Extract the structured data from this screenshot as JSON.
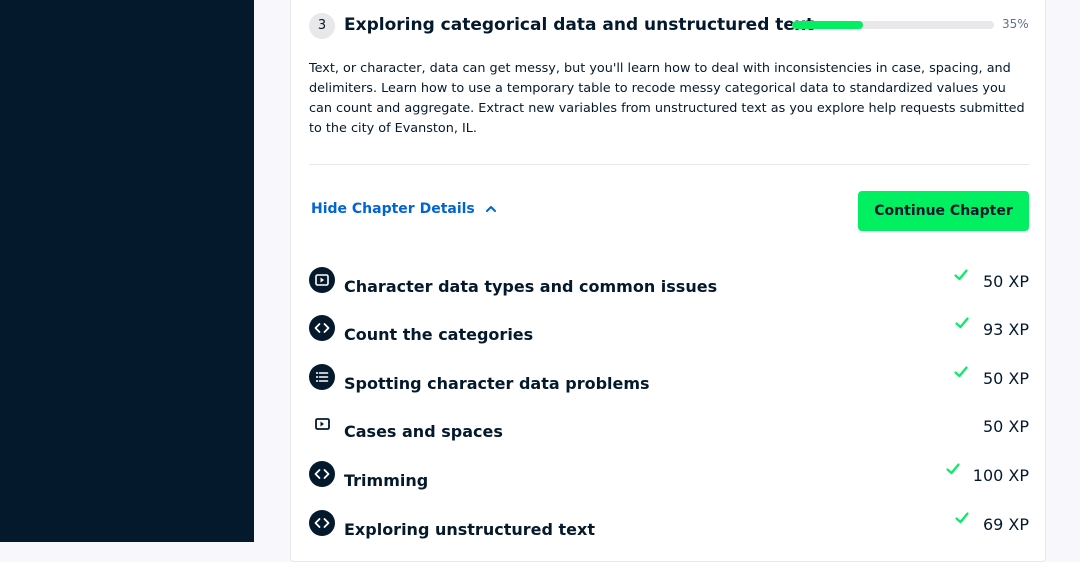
{
  "chapter": {
    "number": "3",
    "title": "Exploring categorical data and unstructured text",
    "progress_percent": 35,
    "progress_label": "35%",
    "description": "Text, or character, data can get messy, but you'll learn how to deal with inconsistencies in case, spacing, and delimiters. Learn how to use a temporary table to recode messy categorical data to standardized values you can count and aggregate. Extract new variables from unstructured text as you explore help requests submitted to the city of Evanston, IL.",
    "hide_details_label": "Hide Chapter Details",
    "continue_label": "Continue Chapter"
  },
  "exercises": [
    {
      "icon": "video-icon",
      "title": "Character data types and common issues",
      "xp": "50 XP",
      "completed": true
    },
    {
      "icon": "code-icon",
      "title": "Count the categories",
      "xp": "93 XP",
      "completed": true
    },
    {
      "icon": "list-icon",
      "title": "Spotting character data problems",
      "xp": "50 XP",
      "completed": true
    },
    {
      "icon": "video-outline-icon",
      "title": "Cases and spaces",
      "xp": "50 XP",
      "completed": false
    },
    {
      "icon": "code-icon",
      "title": "Trimming",
      "xp": "100 XP",
      "completed": true
    },
    {
      "icon": "code-icon",
      "title": "Exploring unstructured text",
      "xp": "69 XP",
      "completed": true
    }
  ],
  "colors": {
    "sidebar": "#05192d",
    "accent_green": "#03ef62",
    "link_blue": "#0065d1",
    "check_green": "#03ef62"
  }
}
